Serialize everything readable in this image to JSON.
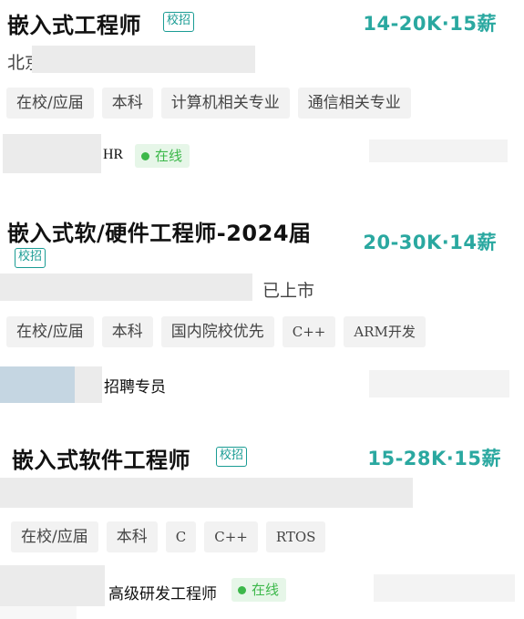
{
  "jobs": [
    {
      "title": "嵌入式工程师",
      "badge": "校招",
      "salary": "14-20K·15薪",
      "company_text": "北京",
      "tags": [
        "在校/应届",
        "本科",
        "计算机相关专业",
        "通信相关专业"
      ],
      "recruiter_title": "HR",
      "online_label": "在线"
    },
    {
      "title": "嵌入式软/硬件工程师-2024届",
      "badge": "校招",
      "salary": "20-30K·14薪",
      "company_text": "已上市",
      "tags": [
        "在校/应届",
        "本科",
        "国内院校优先",
        "C++",
        "ARM开发"
      ],
      "recruiter_title": "招聘专员"
    },
    {
      "title": "嵌入式软件工程师",
      "badge": "校招",
      "salary": "15-28K·15薪",
      "tags": [
        "在校/应届",
        "本科",
        "C",
        "C++",
        "RTOS"
      ],
      "recruiter_title": "高级研发工程师",
      "online_label": "在线"
    }
  ],
  "colors": {
    "accent": "#2aa8a0",
    "badge": "#1a9c94",
    "online": "#3cb84a",
    "tag_bg": "#f2f2f2"
  }
}
